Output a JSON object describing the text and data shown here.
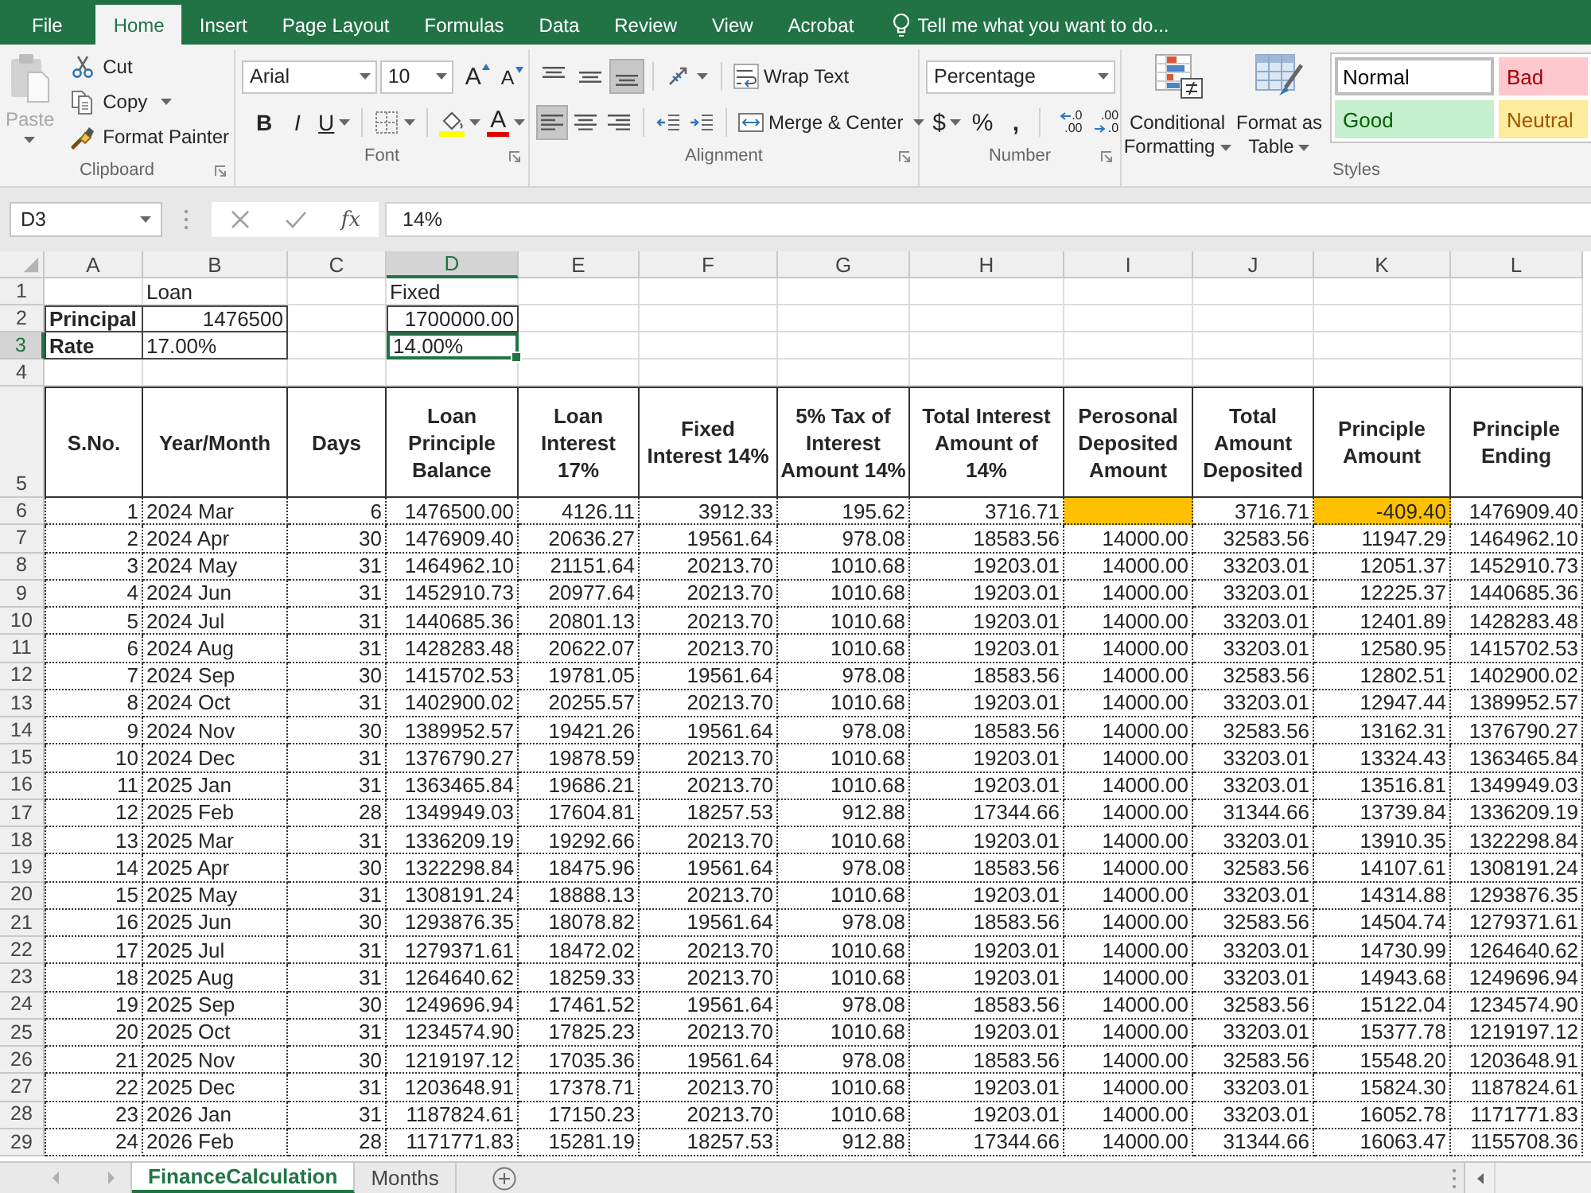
{
  "menu_bar": {
    "tabs": [
      {
        "label": "File",
        "selected": false
      },
      {
        "label": "Home",
        "selected": true
      },
      {
        "label": "Insert",
        "selected": false
      },
      {
        "label": "Page Layout",
        "selected": false
      },
      {
        "label": "Formulas",
        "selected": false
      },
      {
        "label": "Data",
        "selected": false
      },
      {
        "label": "Review",
        "selected": false
      },
      {
        "label": "View",
        "selected": false
      },
      {
        "label": "Acrobat",
        "selected": false
      }
    ],
    "tell_me": {
      "placeholder": "Tell me what you want to do..."
    }
  },
  "ribbon": {
    "clipboard": {
      "label": "Clipboard",
      "paste": {
        "label": "Paste",
        "disabled": true
      },
      "cut": "Cut",
      "copy": "Copy",
      "format_painter": "Format Painter"
    },
    "font": {
      "label": "Font",
      "font_name": "Arial",
      "font_size": "10",
      "grow_font": "A",
      "shrink_font": "A",
      "bold": "B",
      "italic": "I",
      "underline": "U",
      "font_color": "A"
    },
    "alignment": {
      "label": "Alignment",
      "vertical": [
        {
          "kind": "top",
          "selected": false
        },
        {
          "kind": "middle",
          "selected": false
        },
        {
          "kind": "bottom",
          "selected": true
        }
      ],
      "horizontal": [
        {
          "kind": "left",
          "selected": true
        },
        {
          "kind": "center",
          "selected": false
        },
        {
          "kind": "right",
          "selected": false
        }
      ],
      "wrap_text": "Wrap Text",
      "merge_center": "Merge & Center"
    },
    "number": {
      "label": "Number",
      "format": "Percentage",
      "currency": "$",
      "percent": "%",
      "comma": ",",
      "decimals": [
        {
          "kind": "increase",
          "top": ".0",
          "bottom": ".00"
        },
        {
          "kind": "decrease",
          "top": ".00",
          "bottom": ".0"
        }
      ]
    },
    "styles": {
      "label": "Styles",
      "conditional_formatting": "Conditional Formatting",
      "format_as_table": "Format as Table",
      "gallery": [
        {
          "label": "Normal",
          "kind": "normal",
          "selected": true
        },
        {
          "label": "Bad",
          "kind": "bad",
          "selected": false
        },
        {
          "label": "Good",
          "kind": "good",
          "selected": false
        },
        {
          "label": "Neutral",
          "kind": "neutral",
          "selected": false
        }
      ]
    }
  },
  "formula_bar": {
    "name_box": "D3",
    "function_label": "fx",
    "formula": "14%"
  },
  "sheet": {
    "column_headers": [
      {
        "label": "A",
        "selected": false
      },
      {
        "label": "B",
        "selected": false
      },
      {
        "label": "C",
        "selected": false
      },
      {
        "label": "D",
        "selected": true
      },
      {
        "label": "E",
        "selected": false
      },
      {
        "label": "F",
        "selected": false
      },
      {
        "label": "G",
        "selected": false
      },
      {
        "label": "H",
        "selected": false
      },
      {
        "label": "I",
        "selected": false
      },
      {
        "label": "J",
        "selected": false
      },
      {
        "label": "K",
        "selected": false
      },
      {
        "label": "L",
        "selected": false
      }
    ],
    "row_headers": [
      {
        "label": "1",
        "selected": false
      },
      {
        "label": "2",
        "selected": false
      },
      {
        "label": "3",
        "selected": true
      },
      {
        "label": "4",
        "selected": false
      },
      {
        "label": "5",
        "selected": false
      },
      {
        "label": "6",
        "selected": false
      },
      {
        "label": "7",
        "selected": false
      },
      {
        "label": "8",
        "selected": false
      },
      {
        "label": "9",
        "selected": false
      },
      {
        "label": "10",
        "selected": false
      },
      {
        "label": "11",
        "selected": false
      },
      {
        "label": "12",
        "selected": false
      },
      {
        "label": "13",
        "selected": false
      },
      {
        "label": "14",
        "selected": false
      },
      {
        "label": "15",
        "selected": false
      },
      {
        "label": "16",
        "selected": false
      },
      {
        "label": "17",
        "selected": false
      },
      {
        "label": "18",
        "selected": false
      },
      {
        "label": "19",
        "selected": false
      },
      {
        "label": "20",
        "selected": false
      },
      {
        "label": "21",
        "selected": false
      },
      {
        "label": "22",
        "selected": false
      },
      {
        "label": "23",
        "selected": false
      },
      {
        "label": "24",
        "selected": false
      },
      {
        "label": "25",
        "selected": false
      },
      {
        "label": "26",
        "selected": false
      },
      {
        "label": "27",
        "selected": false
      },
      {
        "label": "28",
        "selected": false
      },
      {
        "label": "29",
        "selected": false
      }
    ],
    "inputs": {
      "loan_heading": "Loan",
      "fixed_heading": "Fixed",
      "rows": [
        {
          "label": "Principal",
          "loan": {
            "value": "1476500",
            "kind": "number",
            "selected": false
          },
          "fixed": {
            "value": "1700000.00",
            "kind": "number",
            "selected": false
          }
        },
        {
          "label": "Rate",
          "loan": {
            "value": "17.00%",
            "kind": "text",
            "selected": false
          },
          "fixed": {
            "value": "14.00%",
            "kind": "text",
            "selected": true
          }
        }
      ]
    },
    "table": {
      "columns": [
        "S.No.",
        "Year/Month",
        "Days",
        "Loan\nPrinciple\nBalance",
        "Loan\nInterest\n17%",
        "Fixed\nInterest 14%",
        "5% Tax of\nInterest\nAmount 14%",
        "Total Interest\nAmount of\n14%",
        "Perosonal\nDeposited\nAmount",
        "Total\nAmount\nDeposited",
        "Principle\nAmount",
        "Principle\nEnding"
      ],
      "rows": [
        {
          "cells": [
            "1",
            "2024 Mar",
            "6",
            "1476500.00",
            "4126.11",
            "3912.33",
            "195.62",
            "3716.71",
            {
              "highlighted": true
            },
            "3716.71",
            {
              "value": "-409.40",
              "highlighted": true
            },
            "1476909.40"
          ]
        },
        {
          "cells": [
            "2",
            "2024 Apr",
            "30",
            "1476909.40",
            "20636.27",
            "19561.64",
            "978.08",
            "18583.56",
            "14000.00",
            "32583.56",
            "11947.29",
            "1464962.10"
          ]
        },
        {
          "cells": [
            "3",
            "2024 May",
            "31",
            "1464962.10",
            "21151.64",
            "20213.70",
            "1010.68",
            "19203.01",
            "14000.00",
            "33203.01",
            "12051.37",
            "1452910.73"
          ]
        },
        {
          "cells": [
            "4",
            "2024 Jun",
            "31",
            "1452910.73",
            "20977.64",
            "20213.70",
            "1010.68",
            "19203.01",
            "14000.00",
            "33203.01",
            "12225.37",
            "1440685.36"
          ]
        },
        {
          "cells": [
            "5",
            "2024 Jul",
            "31",
            "1440685.36",
            "20801.13",
            "20213.70",
            "1010.68",
            "19203.01",
            "14000.00",
            "33203.01",
            "12401.89",
            "1428283.48"
          ]
        },
        {
          "cells": [
            "6",
            "2024 Aug",
            "31",
            "1428283.48",
            "20622.07",
            "20213.70",
            "1010.68",
            "19203.01",
            "14000.00",
            "33203.01",
            "12580.95",
            "1415702.53"
          ]
        },
        {
          "cells": [
            "7",
            "2024 Sep",
            "30",
            "1415702.53",
            "19781.05",
            "19561.64",
            "978.08",
            "18583.56",
            "14000.00",
            "32583.56",
            "12802.51",
            "1402900.02"
          ]
        },
        {
          "cells": [
            "8",
            "2024 Oct",
            "31",
            "1402900.02",
            "20255.57",
            "20213.70",
            "1010.68",
            "19203.01",
            "14000.00",
            "33203.01",
            "12947.44",
            "1389952.57"
          ]
        },
        {
          "cells": [
            "9",
            "2024 Nov",
            "30",
            "1389952.57",
            "19421.26",
            "19561.64",
            "978.08",
            "18583.56",
            "14000.00",
            "32583.56",
            "13162.31",
            "1376790.27"
          ]
        },
        {
          "cells": [
            "10",
            "2024 Dec",
            "31",
            "1376790.27",
            "19878.59",
            "20213.70",
            "1010.68",
            "19203.01",
            "14000.00",
            "33203.01",
            "13324.43",
            "1363465.84"
          ]
        },
        {
          "cells": [
            "11",
            "2025 Jan",
            "31",
            "1363465.84",
            "19686.21",
            "20213.70",
            "1010.68",
            "19203.01",
            "14000.00",
            "33203.01",
            "13516.81",
            "1349949.03"
          ]
        },
        {
          "cells": [
            "12",
            "2025 Feb",
            "28",
            "1349949.03",
            "17604.81",
            "18257.53",
            "912.88",
            "17344.66",
            "14000.00",
            "31344.66",
            "13739.84",
            "1336209.19"
          ]
        },
        {
          "cells": [
            "13",
            "2025 Mar",
            "31",
            "1336209.19",
            "19292.66",
            "20213.70",
            "1010.68",
            "19203.01",
            "14000.00",
            "33203.01",
            "13910.35",
            "1322298.84"
          ]
        },
        {
          "cells": [
            "14",
            "2025 Apr",
            "30",
            "1322298.84",
            "18475.96",
            "19561.64",
            "978.08",
            "18583.56",
            "14000.00",
            "32583.56",
            "14107.61",
            "1308191.24"
          ]
        },
        {
          "cells": [
            "15",
            "2025 May",
            "31",
            "1308191.24",
            "18888.13",
            "20213.70",
            "1010.68",
            "19203.01",
            "14000.00",
            "33203.01",
            "14314.88",
            "1293876.35"
          ]
        },
        {
          "cells": [
            "16",
            "2025 Jun",
            "30",
            "1293876.35",
            "18078.82",
            "19561.64",
            "978.08",
            "18583.56",
            "14000.00",
            "32583.56",
            "14504.74",
            "1279371.61"
          ]
        },
        {
          "cells": [
            "17",
            "2025 Jul",
            "31",
            "1279371.61",
            "18472.02",
            "20213.70",
            "1010.68",
            "19203.01",
            "14000.00",
            "33203.01",
            "14730.99",
            "1264640.62"
          ]
        },
        {
          "cells": [
            "18",
            "2025 Aug",
            "31",
            "1264640.62",
            "18259.33",
            "20213.70",
            "1010.68",
            "19203.01",
            "14000.00",
            "33203.01",
            "14943.68",
            "1249696.94"
          ]
        },
        {
          "cells": [
            "19",
            "2025 Sep",
            "30",
            "1249696.94",
            "17461.52",
            "19561.64",
            "978.08",
            "18583.56",
            "14000.00",
            "32583.56",
            "15122.04",
            "1234574.90"
          ]
        },
        {
          "cells": [
            "20",
            "2025 Oct",
            "31",
            "1234574.90",
            "17825.23",
            "20213.70",
            "1010.68",
            "19203.01",
            "14000.00",
            "33203.01",
            "15377.78",
            "1219197.12"
          ]
        },
        {
          "cells": [
            "21",
            "2025 Nov",
            "30",
            "1219197.12",
            "17035.36",
            "19561.64",
            "978.08",
            "18583.56",
            "14000.00",
            "32583.56",
            "15548.20",
            "1203648.91"
          ]
        },
        {
          "cells": [
            "22",
            "2025 Dec",
            "31",
            "1203648.91",
            "17378.71",
            "20213.70",
            "1010.68",
            "19203.01",
            "14000.00",
            "33203.01",
            "15824.30",
            "1187824.61"
          ]
        },
        {
          "cells": [
            "23",
            "2026 Jan",
            "31",
            "1187824.61",
            "17150.23",
            "20213.70",
            "1010.68",
            "19203.01",
            "14000.00",
            "33203.01",
            "16052.78",
            "1171771.83"
          ]
        },
        {
          "cells": [
            "24",
            "2026 Feb",
            "28",
            "1171771.83",
            "15281.19",
            "18257.53",
            "912.88",
            "17344.66",
            "14000.00",
            "31344.66",
            "16063.47",
            "1155708.36"
          ]
        }
      ]
    }
  },
  "sheet_tabs": [
    {
      "label": "FinanceCalculation",
      "selected": true
    },
    {
      "label": "Months",
      "selected": false
    }
  ]
}
